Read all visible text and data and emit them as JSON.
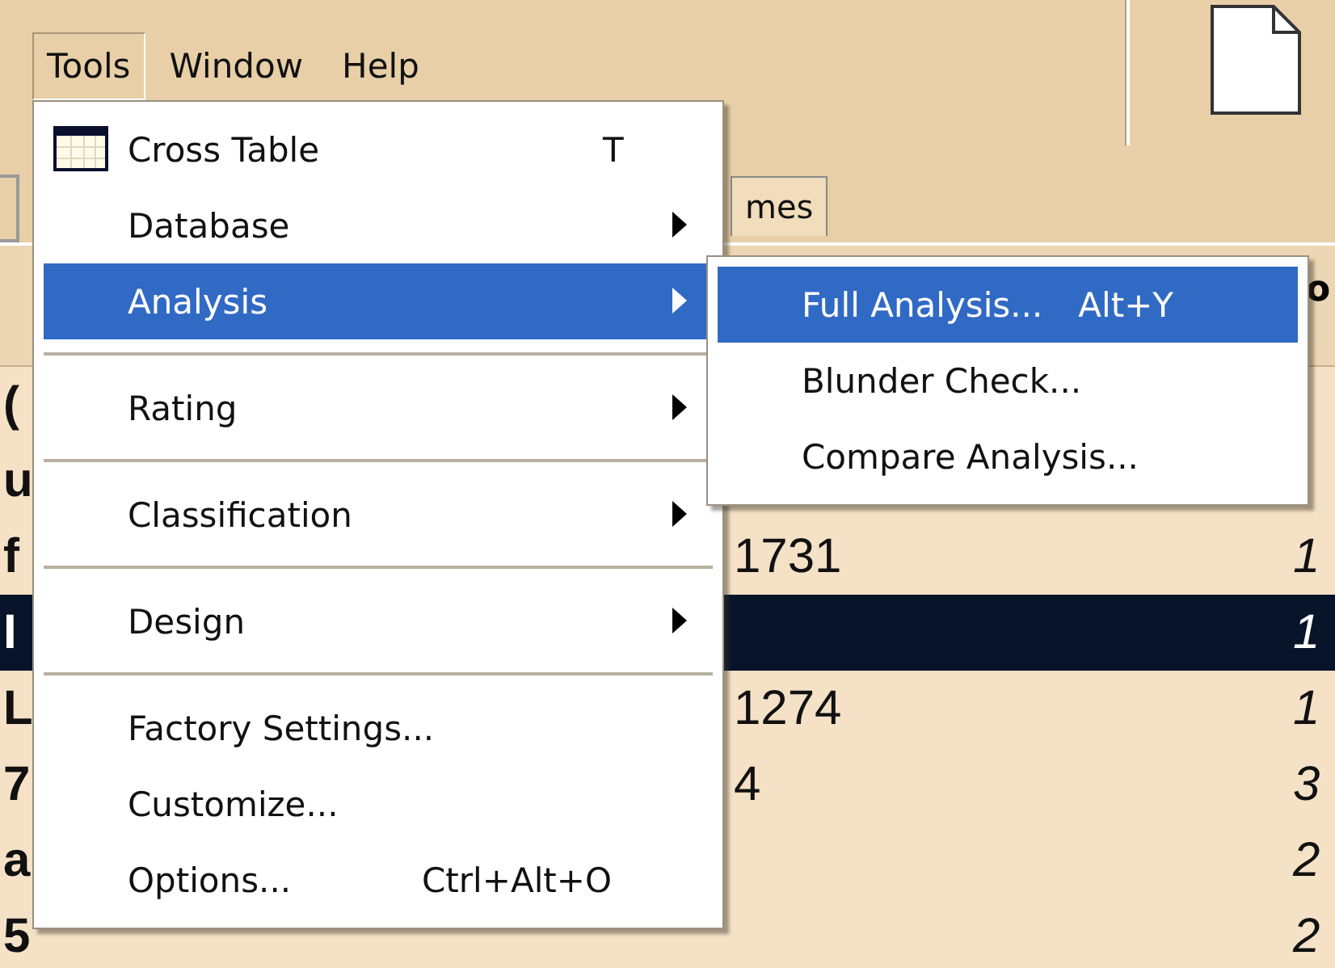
{
  "menubar": [
    {
      "label": "Tools",
      "selected": true
    },
    {
      "label": "Window",
      "selected": false
    },
    {
      "label": "Help",
      "selected": false
    }
  ],
  "tabs": [
    {
      "label": "mes",
      "selected": false
    }
  ],
  "table": {
    "header": {
      "column_4": "o"
    },
    "rows": [
      {
        "column_1": "(",
        "selected": false
      },
      {
        "column_1": "u",
        "selected": false
      },
      {
        "column_1": "f",
        "column_3": "1731",
        "column_4": "1",
        "selected": false
      },
      {
        "column_1": "I",
        "column_4": "1",
        "selected": true
      },
      {
        "column_1": "L",
        "column_3": "1274",
        "column_4": "1",
        "selected": false
      },
      {
        "column_1": "7",
        "column_3": "4",
        "column_4": "3",
        "selected": false
      },
      {
        "column_1": "a",
        "column_4": "2",
        "selected": false
      },
      {
        "column_1": "5",
        "column_4": "2",
        "selected": false
      }
    ]
  },
  "menu": {
    "items": [
      {
        "kind": "command",
        "label": "Cross Table",
        "shortcut": "T",
        "selected": false
      },
      {
        "kind": "submenu",
        "label": "Database",
        "selected": false
      },
      {
        "kind": "submenu",
        "label": "Analysis",
        "selected": true
      },
      {
        "kind": "separator"
      },
      {
        "kind": "submenu",
        "label": "Rating",
        "selected": false
      },
      {
        "kind": "separator"
      },
      {
        "kind": "submenu",
        "label": "Classification",
        "selected": false
      },
      {
        "kind": "separator"
      },
      {
        "kind": "submenu",
        "label": "Design",
        "selected": false
      },
      {
        "kind": "separator"
      },
      {
        "kind": "command",
        "label": "Factory Settings...",
        "selected": false
      },
      {
        "kind": "command",
        "label": "Customize...",
        "selected": false
      },
      {
        "kind": "command",
        "label": "Options...",
        "shortcut": "Ctrl+Alt+O",
        "selected": false
      }
    ]
  },
  "submenu": {
    "items": [
      {
        "kind": "command",
        "label": "Full Analysis...",
        "shortcut": "Alt+Y",
        "selected": true
      },
      {
        "kind": "command",
        "label": "Blunder Check...",
        "selected": false
      },
      {
        "kind": "command",
        "label": "Compare Analysis...",
        "selected": false
      }
    ]
  }
}
